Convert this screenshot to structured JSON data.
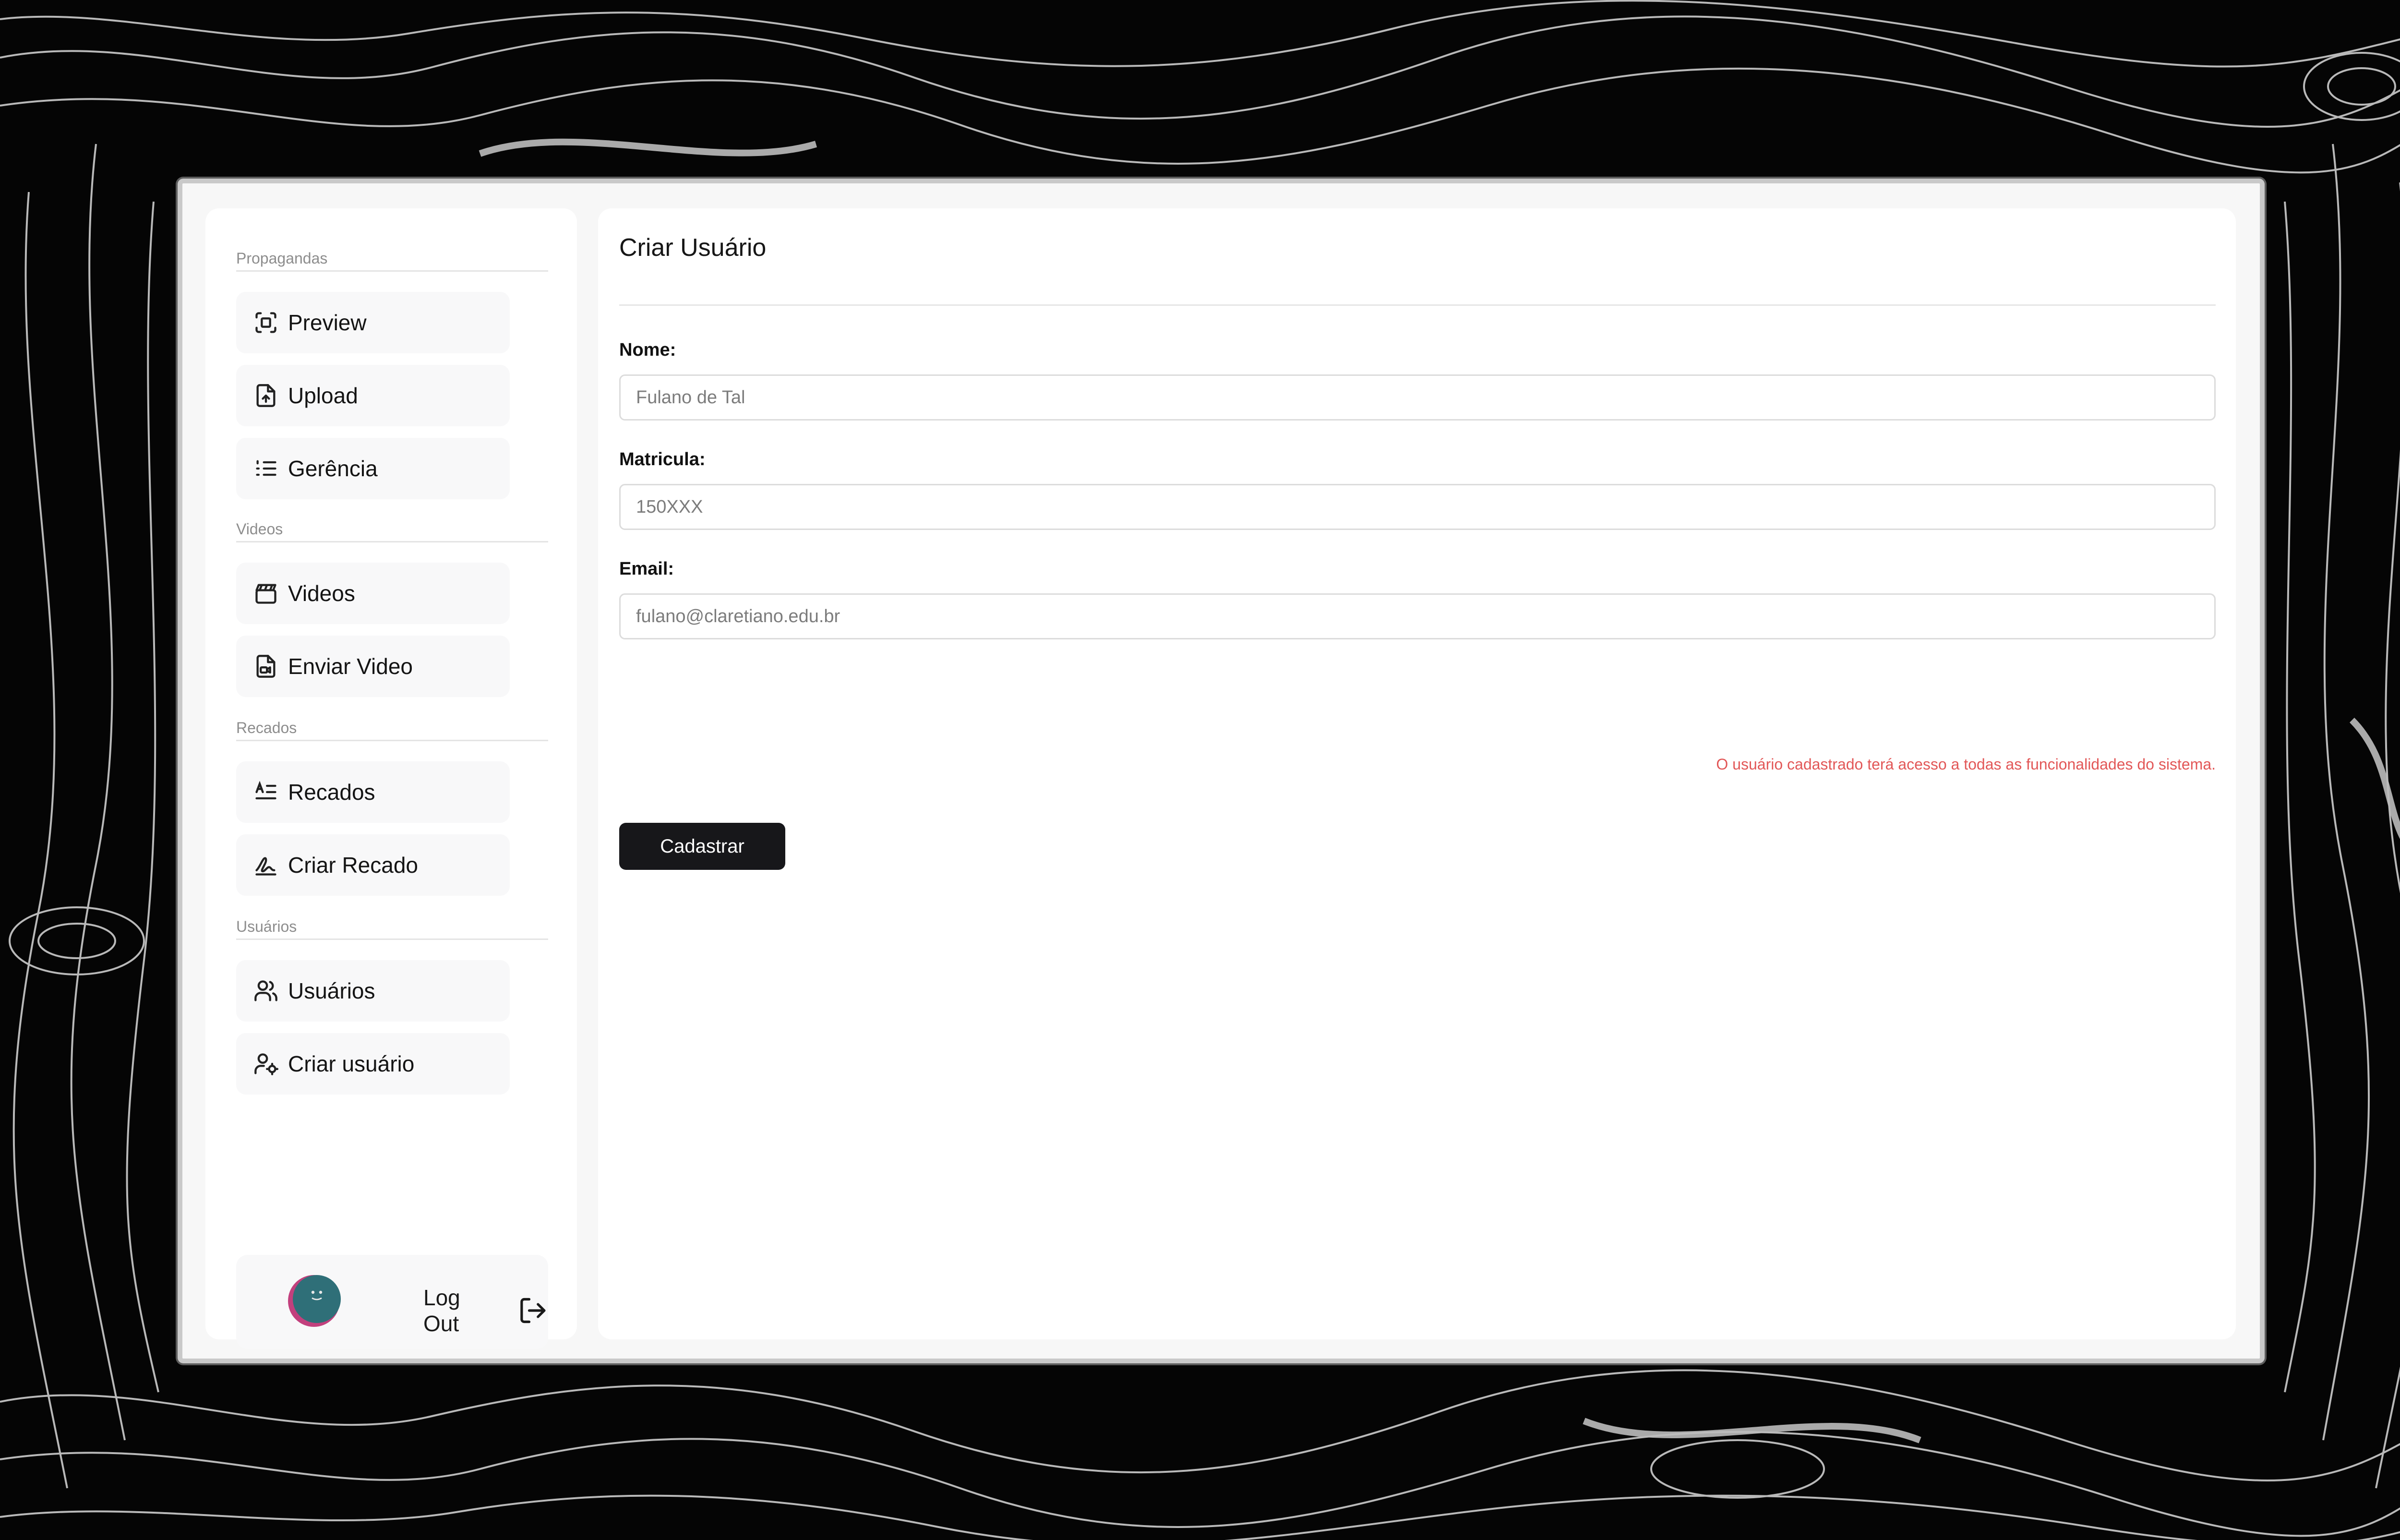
{
  "sidebar": {
    "sections": [
      {
        "label": "Propagandas",
        "items": [
          {
            "label": "Preview",
            "icon": "scan-icon"
          },
          {
            "label": "Upload",
            "icon": "file-upload-icon"
          },
          {
            "label": "Gerência",
            "icon": "list-icon"
          }
        ]
      },
      {
        "label": "Videos",
        "items": [
          {
            "label": "Videos",
            "icon": "clapperboard-icon"
          },
          {
            "label": "Enviar Video",
            "icon": "file-video-icon"
          }
        ]
      },
      {
        "label": "Recados",
        "items": [
          {
            "label": "Recados",
            "icon": "text-lines-icon"
          },
          {
            "label": "Criar Recado",
            "icon": "signature-icon"
          }
        ]
      },
      {
        "label": "Usuários",
        "items": [
          {
            "label": "Usuários",
            "icon": "users-icon"
          },
          {
            "label": "Criar usuário",
            "icon": "user-cog-icon"
          }
        ]
      }
    ],
    "logout_label": "Log Out"
  },
  "main": {
    "title": "Criar Usuário",
    "fields": [
      {
        "label": "Nome:",
        "placeholder": "Fulano de Tal",
        "value": ""
      },
      {
        "label": "Matricula:",
        "placeholder": "150XXX",
        "value": ""
      },
      {
        "label": "Email:",
        "placeholder": "fulano@claretiano.edu.br",
        "value": ""
      }
    ],
    "notice": "O usuário cadastrado terá acesso a todas as funcionalidades do sistema.",
    "submit_label": "Cadastrar"
  },
  "colors": {
    "background": "#050505",
    "button": "#17171a",
    "notice": "#e25757",
    "avatar_primary": "#2f6f78",
    "avatar_accent": "#c2407d"
  }
}
